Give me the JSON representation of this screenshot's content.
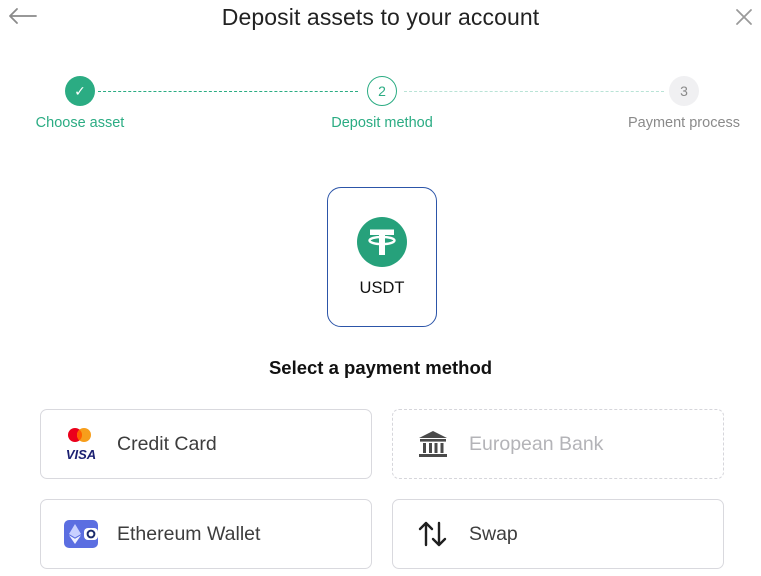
{
  "header": {
    "title": "Deposit assets to your account",
    "back_icon": "arrow-left-icon",
    "close_icon": "close-icon"
  },
  "stepper": {
    "steps": [
      {
        "label": "Choose asset",
        "status": "completed",
        "marker": "✓"
      },
      {
        "label": "Deposit method",
        "status": "active",
        "marker": "2"
      },
      {
        "label": "Payment process",
        "status": "pending",
        "marker": "3"
      }
    ]
  },
  "asset": {
    "symbol": "USDT",
    "icon": "tether-icon",
    "color": "#26a17b"
  },
  "payment": {
    "title": "Select a payment method",
    "methods": [
      {
        "label": "Credit Card",
        "icon": "mastercard-visa-icon",
        "enabled": true
      },
      {
        "label": "European Bank",
        "icon": "bank-icon",
        "enabled": false
      },
      {
        "label": "Ethereum Wallet",
        "icon": "ethereum-wallet-icon",
        "enabled": true
      },
      {
        "label": "Swap",
        "icon": "swap-arrows-icon",
        "enabled": true
      }
    ]
  },
  "colors": {
    "accent": "#2bac83",
    "selected_border": "#2c55a8",
    "disabled_text": "#b4b4b8"
  }
}
